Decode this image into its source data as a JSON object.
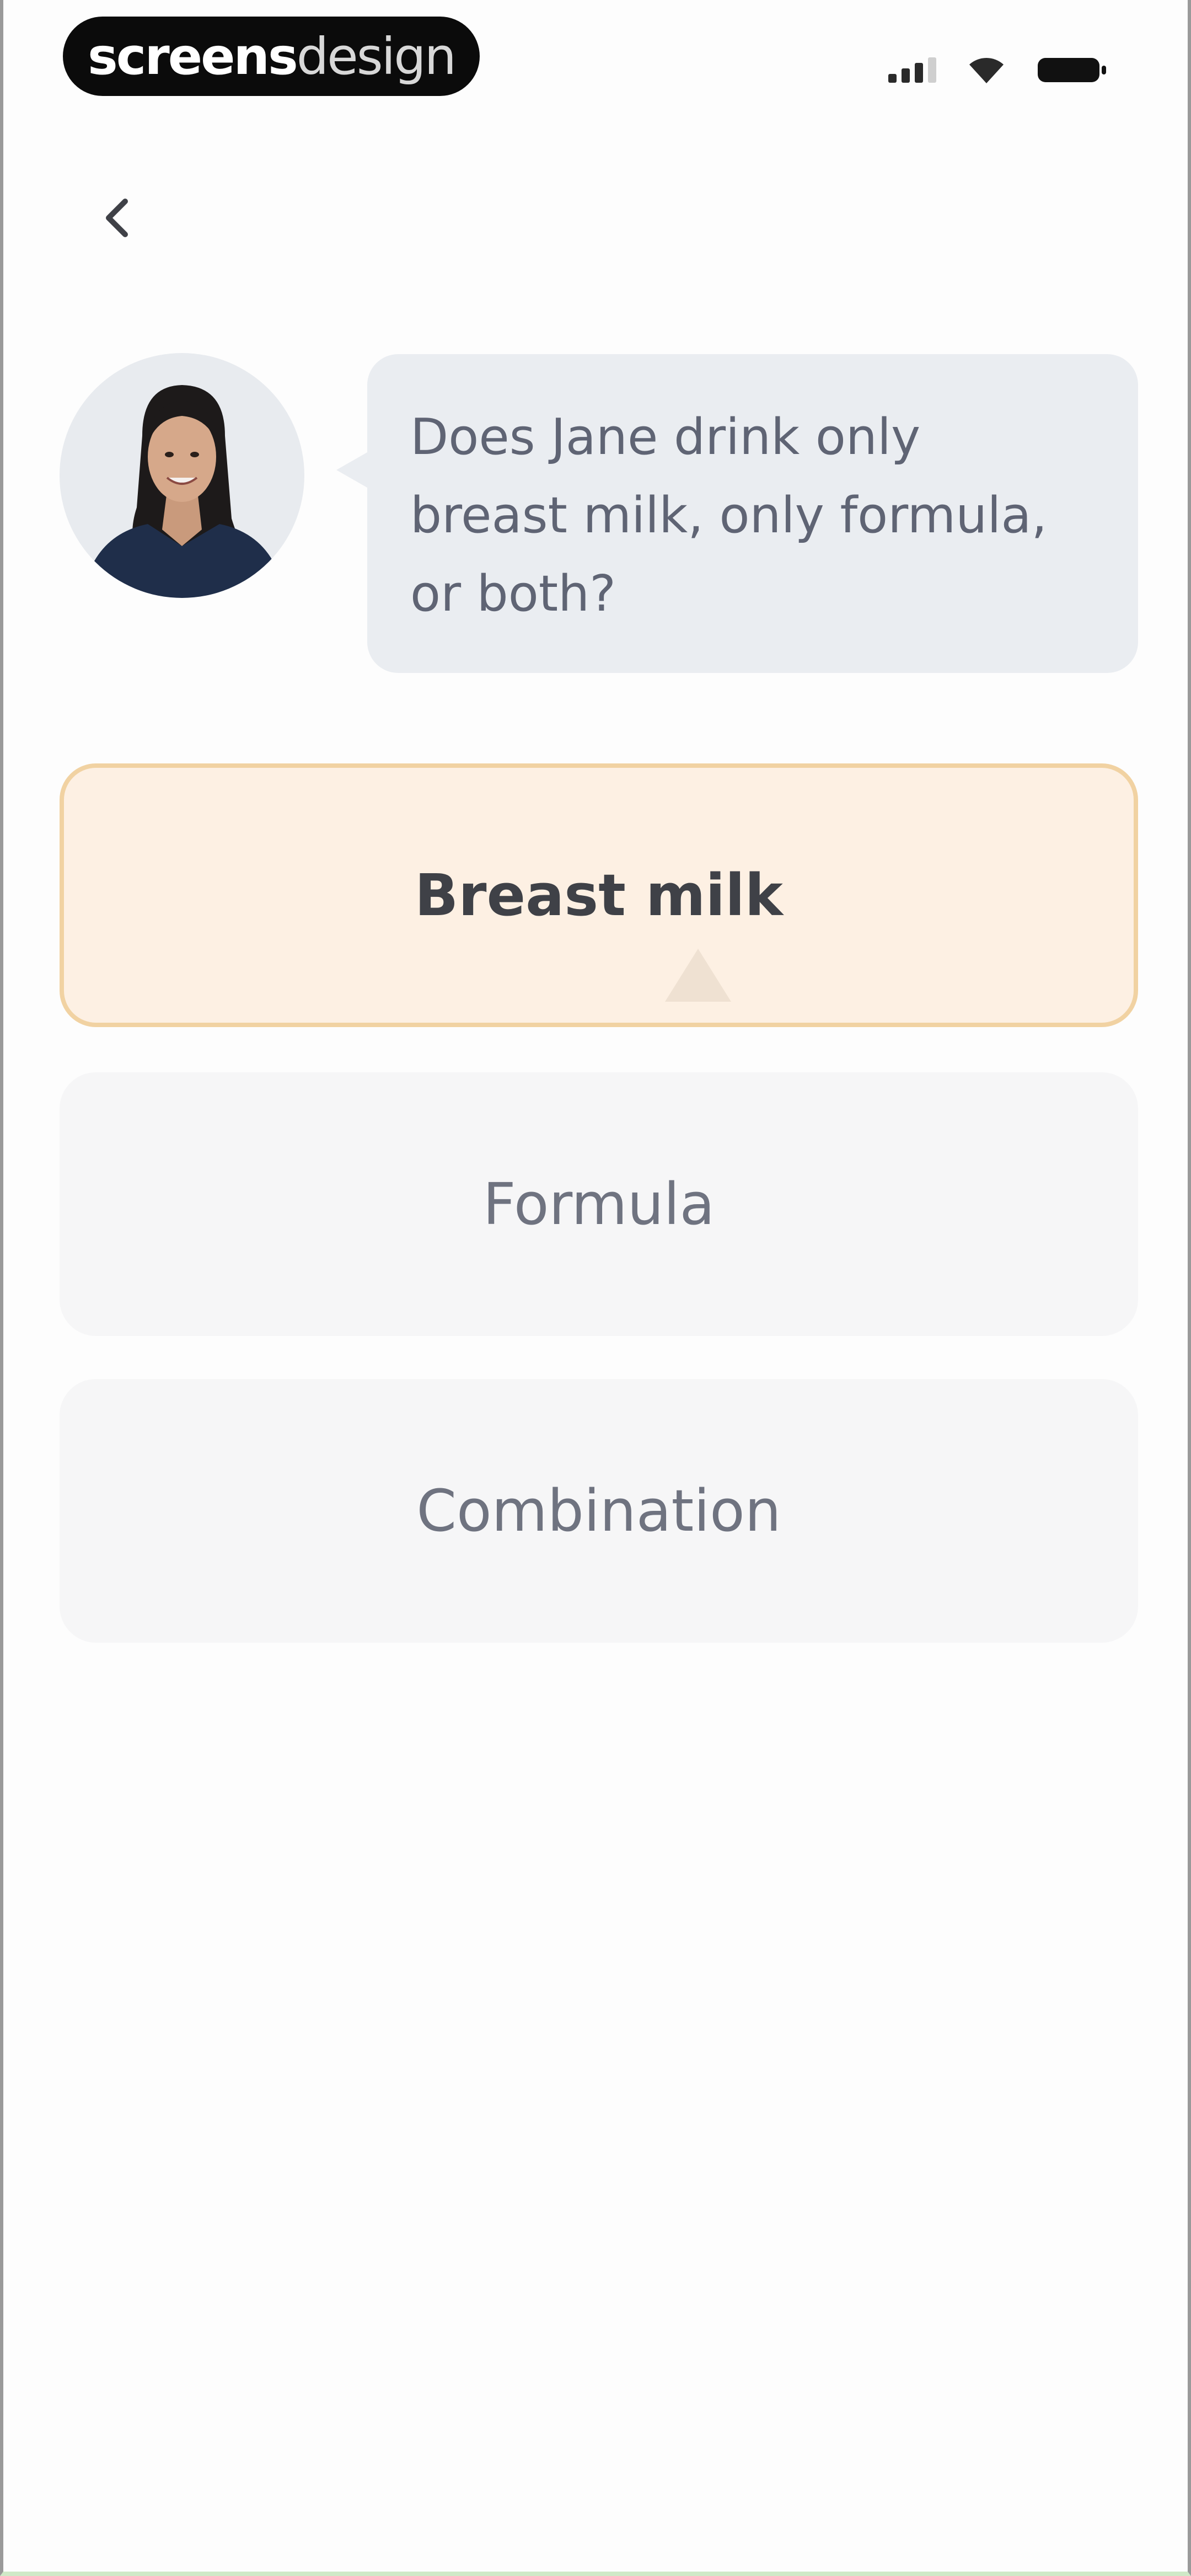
{
  "status_bar": {
    "watermark_strong": "screens",
    "watermark_light": "design",
    "icons": [
      "signal-icon",
      "wifi-icon",
      "battery-icon"
    ]
  },
  "nav": {
    "back_icon": "chevron-left-icon"
  },
  "question": {
    "avatar_icon": "avatar",
    "lines": [
      "Does Jane drink only",
      "breast milk, only formula,",
      "or both?"
    ]
  },
  "options": [
    {
      "label": "Breast milk",
      "selected": true
    },
    {
      "label": "Formula",
      "selected": false
    },
    {
      "label": "Combination",
      "selected": false
    }
  ],
  "colors": {
    "selected_bg": "#fdf0e3",
    "selected_border": "#f1d2a2",
    "option_bg": "#f6f6f7",
    "bubble_bg": "#eaedf1",
    "text_dark": "#3f4147",
    "text_muted": "#6f7380"
  }
}
